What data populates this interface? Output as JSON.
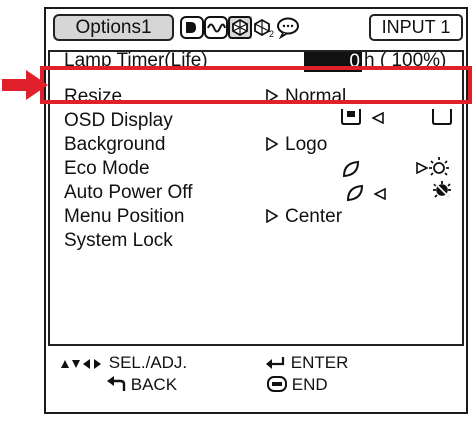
{
  "header": {
    "tab_label": "Options1",
    "input_label": "INPUT 1",
    "icons": [
      "picture-tab-icon",
      "signal-tab-icon",
      "options1-tab-icon",
      "options2-tab-icon",
      "language-tab-icon"
    ]
  },
  "menu": {
    "items": [
      {
        "label": "Lamp Timer(Life)",
        "value": "0",
        "suffix": "h (  100%)"
      },
      {
        "label": "Resize",
        "value": "Normal"
      },
      {
        "label": "OSD Display",
        "value": ""
      },
      {
        "label": "Background",
        "value": "Logo"
      },
      {
        "label": "Eco Mode",
        "value": ""
      },
      {
        "label": "Auto Power Off",
        "value": ""
      },
      {
        "label": "Menu Position",
        "value": "Center"
      },
      {
        "label": "System Lock",
        "value": ""
      }
    ]
  },
  "footer": {
    "sel_adj": "SEL./ADJ.",
    "enter": "ENTER",
    "back": "BACK",
    "end": "END"
  },
  "colors": {
    "highlight": "#e0202a",
    "pointer": "#e0202a",
    "tab_fill": "#d6d6d6"
  }
}
